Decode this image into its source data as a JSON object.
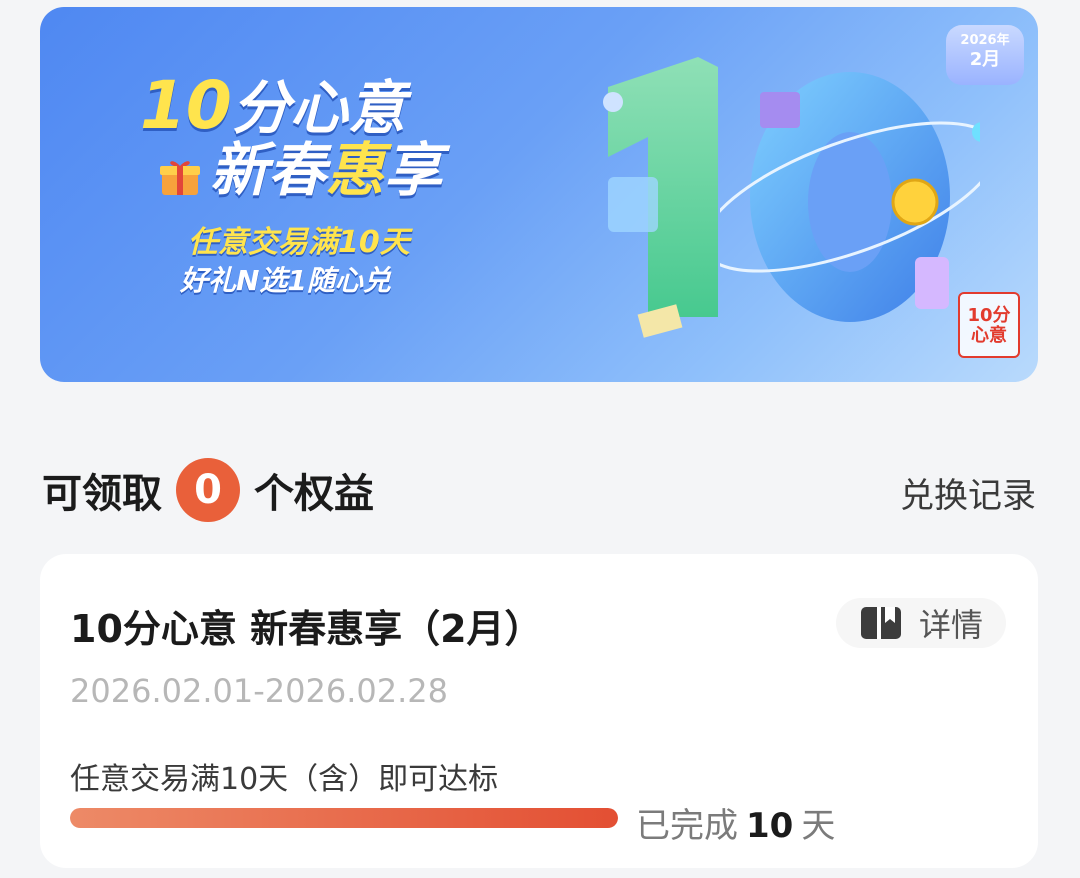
{
  "banner": {
    "title_num": "10",
    "title_rest": "分心意",
    "title_line2_a": "新春",
    "title_line2_b": "惠",
    "title_line2_c": "享",
    "sub1": "任意交易满10天",
    "sub2": "好礼N选1随心兑",
    "date_year": "2026年",
    "date_month": "2月",
    "stamp_text_top": "10分",
    "stamp_text_bottom": "心意",
    "colors": {
      "accent_yellow": "#ffe44d",
      "bg_blue": "#4f88f2"
    }
  },
  "heading": {
    "prefix": "可领取",
    "count": "0",
    "suffix": "个权益",
    "records_link": "兑换记录"
  },
  "card": {
    "title": "10分心意 新春惠享（2月）",
    "detail_label": "详情",
    "date_range": "2026.02.01-2026.02.28",
    "requirement": "任意交易满10天（含）即可达标",
    "progress_prefix": "已完成",
    "progress_days": "10",
    "progress_unit": "天",
    "progress_fraction": 1.0,
    "colors": {
      "progress": "#e34f33",
      "badge": "#e9603a"
    }
  }
}
